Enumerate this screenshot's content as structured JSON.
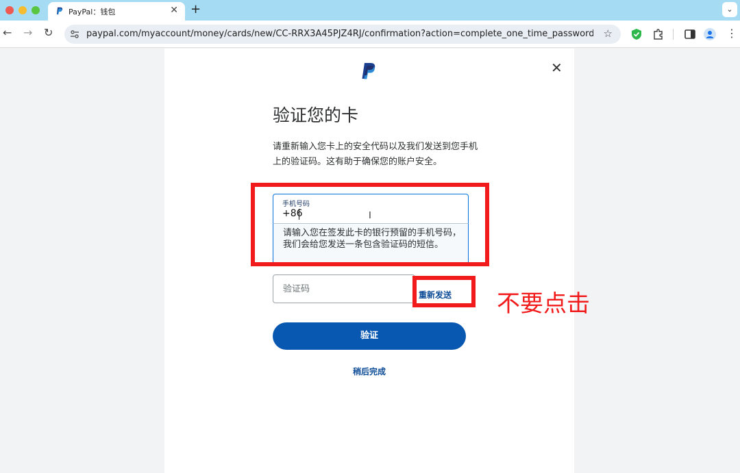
{
  "browser": {
    "tab_title": "PayPal：钱包",
    "tab_close": "✕",
    "new_tab": "+",
    "tab_menu": "⌄",
    "url": "paypal.com/myaccount/money/cards/new/CC-RRX3A45PJZ4RJ/confirmation?action=complete_one_time_password_confirmation...",
    "back": "←",
    "forward": "→",
    "reload": "↻",
    "star": "☆",
    "kebab": "⋮",
    "colors": {
      "tab_bar": "#a6dcf3",
      "toolbar": "#ffffff",
      "omnibox": "#e9eef4"
    }
  },
  "page": {
    "close": "✕",
    "title": "验证您的卡",
    "description": "请重新输入您卡上的安全代码以及我们发送到您手机上的验证码。这有助于确保您的账户安全。",
    "phone": {
      "label": "手机号码",
      "value": "+86",
      "help": "请输入您在签发此卡的银行预留的手机号码，我们会给您发送一条包含验证码的短信。"
    },
    "code": {
      "placeholder": "验证码"
    },
    "resend": "重新发送",
    "verify": "验证",
    "later": "稍后完成",
    "annotation": "不要点击",
    "colors": {
      "primary": "#0857b1",
      "link": "#0c4b96",
      "annotation_red": "#f21b1b",
      "focus_blue": "#0070e0"
    }
  }
}
